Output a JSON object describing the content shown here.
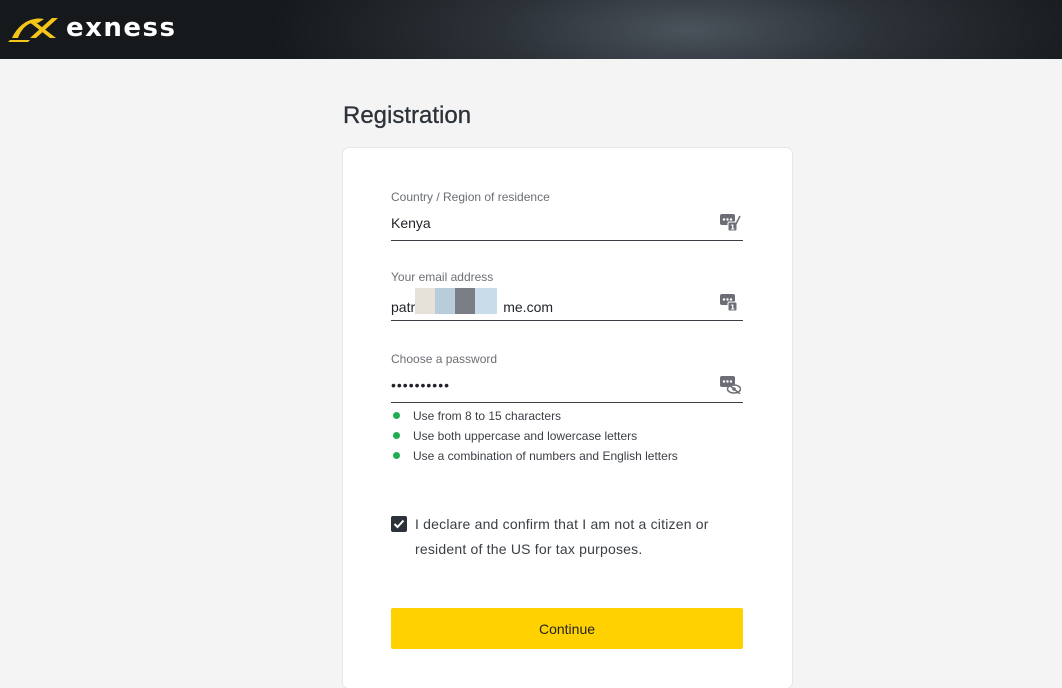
{
  "brand": {
    "name": "exness",
    "logo_icon": "exness-logo-mark",
    "logo_color": "#f5c518"
  },
  "page": {
    "title": "Registration"
  },
  "form": {
    "country": {
      "label": "Country / Region of residence",
      "value": "Kenya",
      "icon": "autofill-key-icon"
    },
    "email": {
      "label": "Your email address",
      "value_start": "patric",
      "value_end": "me.com",
      "icon": "autofill-key-icon"
    },
    "password": {
      "label": "Choose a password",
      "value": "••••••••••",
      "icon": "hide-password-icon"
    },
    "rules": [
      {
        "text": "Use from 8 to 15 characters",
        "status": "passed"
      },
      {
        "text": "Use both uppercase and lowercase letters",
        "status": "passed"
      },
      {
        "text": "Use a combination of numbers and English letters",
        "status": "passed"
      }
    ],
    "declaration": {
      "checked": true,
      "text": "I declare and confirm that I am not a citizen or resident of the US for tax purposes."
    },
    "submit_label": "Continue"
  },
  "colors": {
    "accent": "#ffd100",
    "rule_ok": "#1fae4f",
    "header_bg": "#1c2024"
  }
}
